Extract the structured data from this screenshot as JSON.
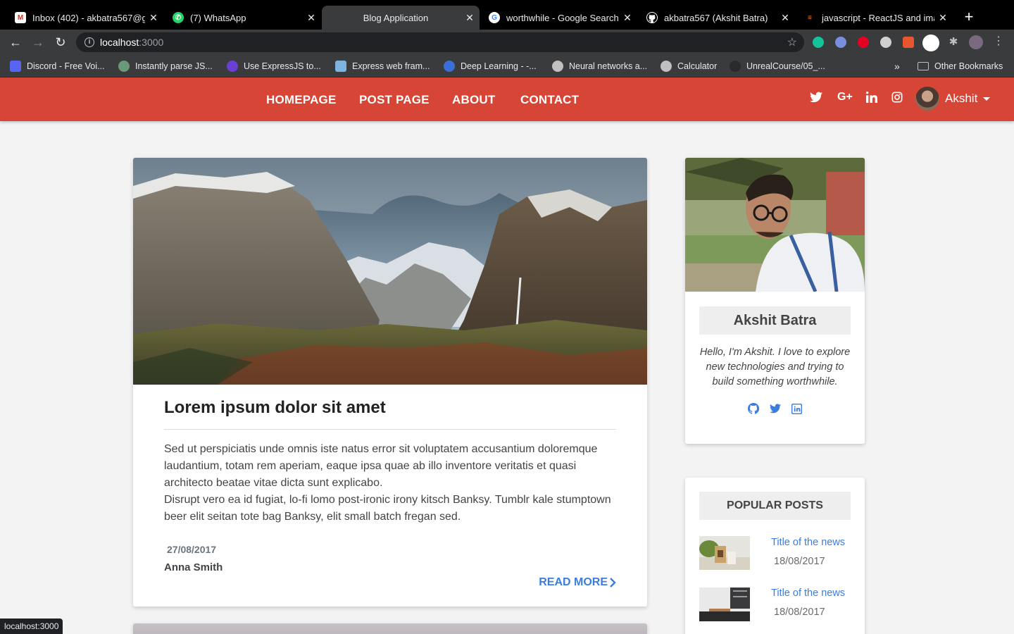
{
  "browser": {
    "tabs": [
      {
        "title": "Inbox (402) - akbatra567@g",
        "favicon": "gmail-icon",
        "active": false
      },
      {
        "title": "(7) WhatsApp",
        "favicon": "whatsapp-icon",
        "active": false
      },
      {
        "title": "Blog Application",
        "favicon": "",
        "active": true
      },
      {
        "title": "worthwhile - Google Search",
        "favicon": "google-icon",
        "active": false
      },
      {
        "title": "akbatra567 (Akshit Batra)",
        "favicon": "github-icon",
        "active": false
      },
      {
        "title": "javascript - ReactJS and ima",
        "favicon": "stackoverflow-icon",
        "active": false
      }
    ],
    "url_host": "localhost",
    "url_port": ":3000",
    "bookmarks": [
      "Discord - Free Voi...",
      "Instantly parse JS...",
      "Use ExpressJS to...",
      "Express web fram...",
      "Deep Learning - -...",
      "Neural networks a...",
      "Calculator",
      "UnrealCourse/05_..."
    ],
    "other_bookmarks": "Other Bookmarks",
    "status_url": "localhost:3000"
  },
  "nav": {
    "links": [
      "HOMEPAGE",
      "POST PAGE",
      "ABOUT",
      "CONTACT"
    ],
    "user_name": "Akshit",
    "brand_color": "#d64535"
  },
  "post": {
    "title": "Lorem ipsum dolor sit amet",
    "body_1": "Sed ut perspiciatis unde omnis iste natus error sit voluptatem accusantium doloremque laudantium, totam rem aperiam, eaque ipsa quae ab illo inventore veritatis et quasi architecto beatae vitae dicta sunt explicabo.",
    "body_2": "Disrupt vero ea id fugiat, lo-fi lomo post-ironic irony kitsch Banksy. Tumblr kale stumptown beer elit seitan tote bag Banksy, elit small batch fregan sed.",
    "date": "27/08/2017",
    "author": "Anna Smith",
    "read_more": "READ MORE"
  },
  "profile": {
    "name": "Akshit Batra",
    "bio": "Hello, I'm Akshit. I love to explore new technologies and trying to build something worthwhile.",
    "icons": [
      "github-icon",
      "twitter-icon",
      "linkedin-icon"
    ]
  },
  "popular": {
    "heading": "POPULAR POSTS",
    "items": [
      {
        "title": "Title of the news",
        "date": "18/08/2017"
      },
      {
        "title": "Title of the news",
        "date": "18/08/2017"
      }
    ]
  }
}
